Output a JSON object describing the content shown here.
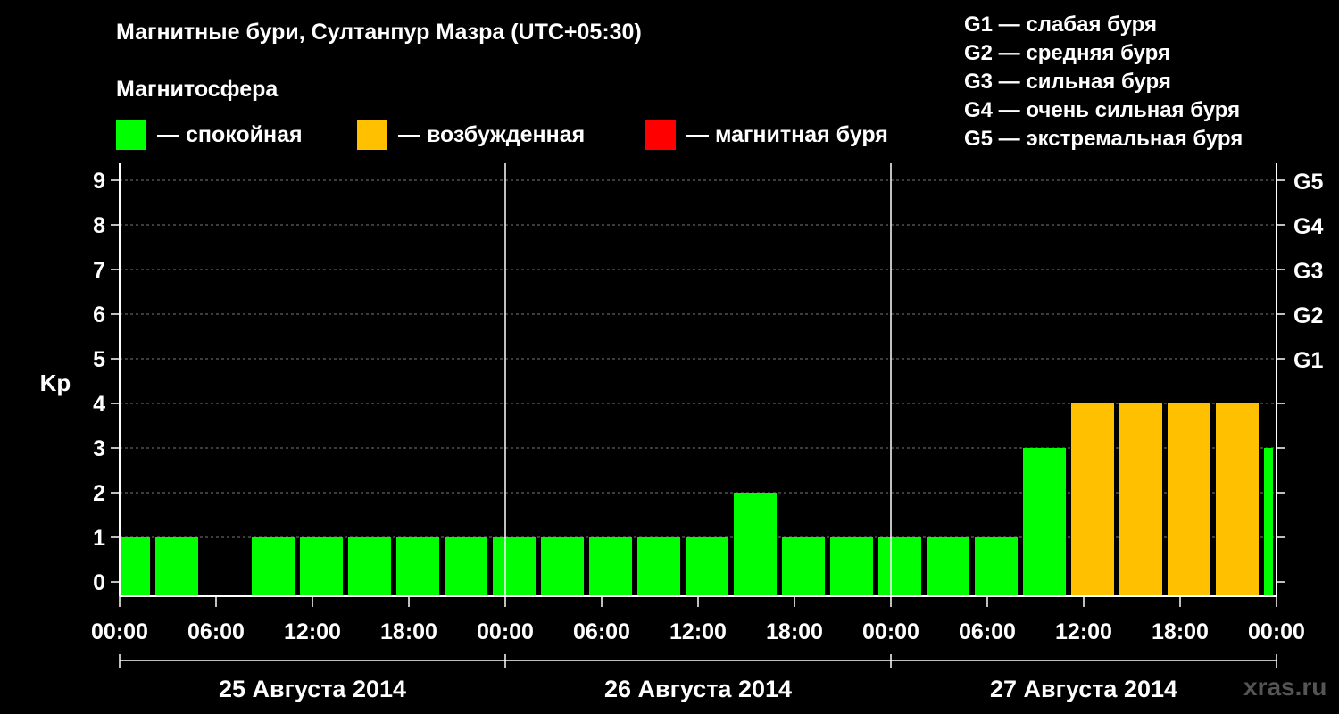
{
  "title": "Магнитные бури, Султанпур Мазра (UTC+05:30)",
  "subtitle": "Магнитосфера",
  "legend": [
    {
      "label": "— спокойная",
      "color": "#00ff00"
    },
    {
      "label": "— возбужденная",
      "color": "#ffc000"
    },
    {
      "label": "— магнитная буря",
      "color": "#ff0000"
    }
  ],
  "g_scale": [
    "G1 — слабая буря",
    "G2 — средняя буря",
    "G3 — сильная буря",
    "G4 — очень сильная буря",
    "G5 — экстремальная буря"
  ],
  "watermark": "xras.ru",
  "chart_data": {
    "type": "bar",
    "ylabel": "Kp",
    "ylim": [
      0,
      9
    ],
    "yticks": [
      "0",
      "1",
      "2",
      "3",
      "4",
      "5",
      "6",
      "7",
      "8",
      "9"
    ],
    "right_labels": [
      {
        "value": 5,
        "label": "G1"
      },
      {
        "value": 6,
        "label": "G2"
      },
      {
        "value": 7,
        "label": "G3"
      },
      {
        "value": 8,
        "label": "G4"
      },
      {
        "value": 9,
        "label": "G5"
      }
    ],
    "xticks": [
      "00:00",
      "06:00",
      "12:00",
      "18:00",
      "00:00",
      "06:00",
      "12:00",
      "18:00",
      "00:00",
      "06:00",
      "12:00",
      "18:00",
      "00:00"
    ],
    "days": [
      "25 Августа 2014",
      "26 Августа 2014",
      "27 Августа 2014"
    ],
    "grid": true,
    "values": [
      1,
      1,
      0,
      1,
      1,
      1,
      1,
      1,
      1,
      1,
      1,
      1,
      1,
      2,
      1,
      1,
      1,
      1,
      1,
      3,
      4,
      4,
      4,
      4,
      3
    ],
    "first_interval_hours": [
      0,
      2
    ],
    "interval_hours": 3,
    "last_interval_hours": [
      71,
      72
    ],
    "colors": {
      "quiet": "#00ff00",
      "active": "#ffc000",
      "storm": "#ff0000"
    }
  }
}
